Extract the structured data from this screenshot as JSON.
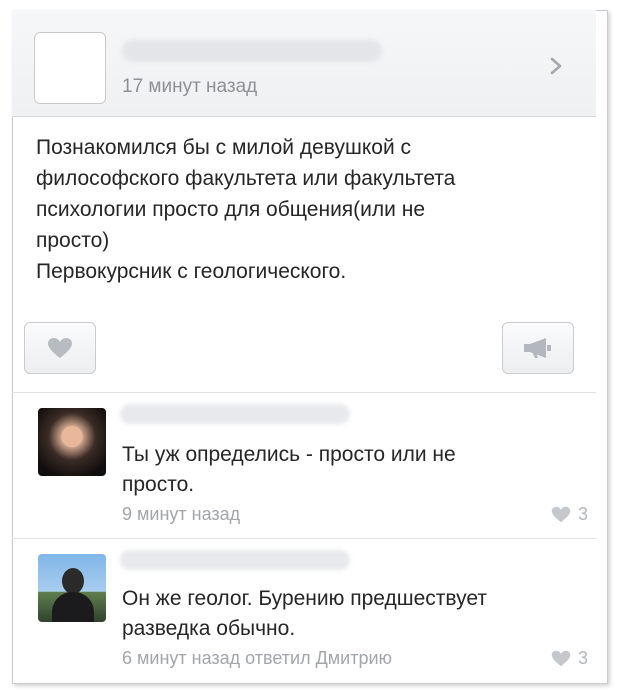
{
  "post": {
    "time": "17 минут назад",
    "text_lines": [
      "Познакомился бы с милой девушкой с",
      "философского факультета или факультета",
      "психологии просто для общения(или не",
      "просто)",
      "Первокурсник с геологического."
    ]
  },
  "comments": [
    {
      "text_lines": [
        "Ты уж определись - просто или не",
        "просто."
      ],
      "meta": "9 минут назад",
      "likes": "3"
    },
    {
      "text_lines": [
        "Он же геолог. Бурению предшествует",
        "разведка обычно."
      ],
      "meta": "6 минут назад ответил Дмитрию",
      "likes": "3"
    }
  ],
  "icons": {
    "like": "heart-icon",
    "share": "megaphone-icon",
    "open": "chevron-right-icon"
  },
  "colors": {
    "meta_gray": "#8d9196",
    "border": "#c9ccd0"
  }
}
